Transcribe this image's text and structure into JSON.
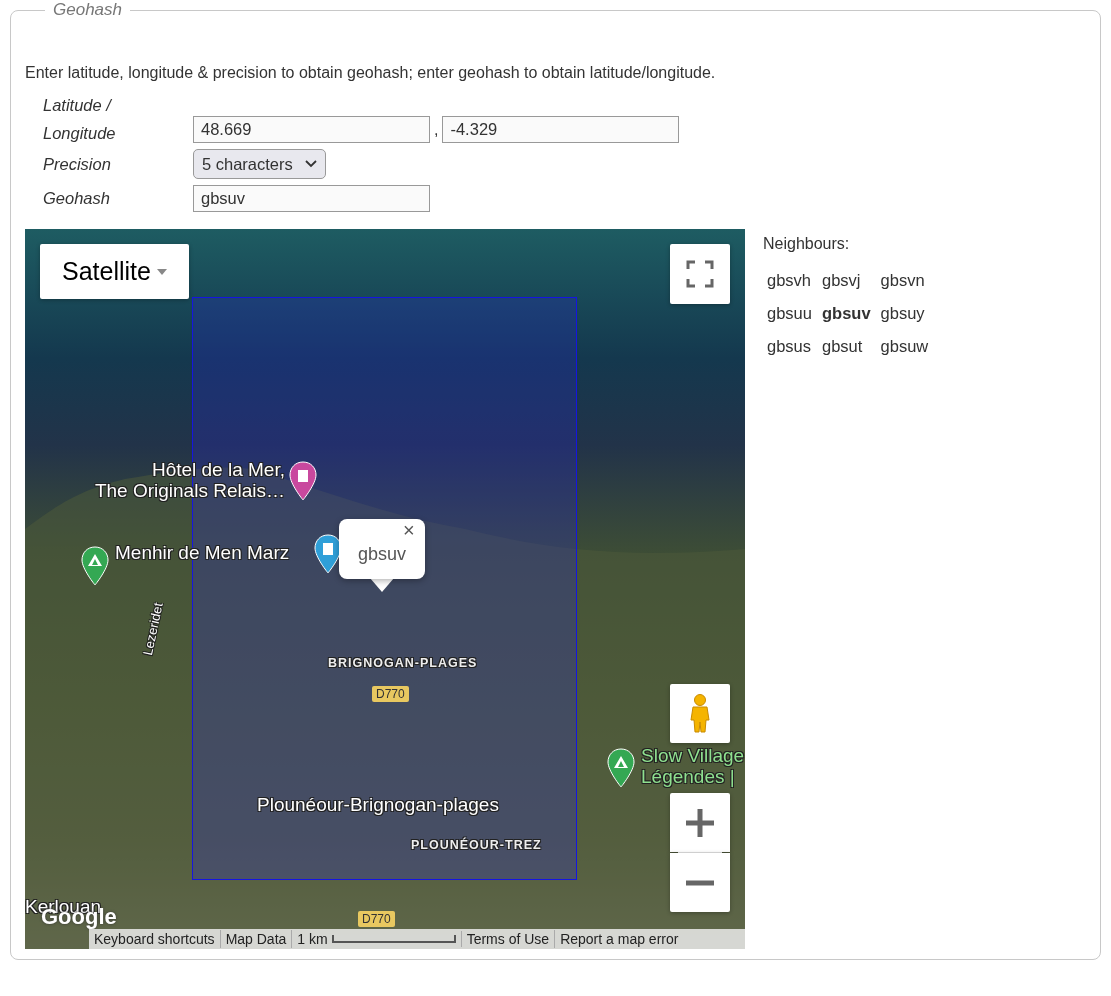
{
  "legend": "Geohash",
  "intro": "Enter latitude, longitude & precision to obtain geohash; enter geohash to obtain latitude/longitude.",
  "form": {
    "latlon_label_line1": "Latitude /",
    "latlon_label_line2": "Longitude",
    "latitude": "48.669",
    "separator": ",",
    "longitude": "-4.329",
    "precision_label": "Precision",
    "precision": "5 characters",
    "geohash_label": "Geohash",
    "geohash": "gbsuv"
  },
  "map": {
    "map_type": "Satellite",
    "labels": [
      {
        "kind": "poi",
        "text": "Hôtel de la Mer,",
        "text2": "The Originals Relais…",
        "color": "#c9489e"
      },
      {
        "kind": "poi",
        "text": "Menhir de Men Marz",
        "color": "#2f9fd8"
      },
      {
        "kind": "place",
        "text": "BRIGNOGAN-PLAGES"
      },
      {
        "kind": "road",
        "text": "D770"
      },
      {
        "kind": "street",
        "text": "Lezeridet"
      },
      {
        "kind": "green",
        "text": "Slow Village",
        "text2": "Légendes |",
        "color": "#34a853"
      },
      {
        "kind": "town",
        "text": "Plounéour-Brignogan-plages"
      },
      {
        "kind": "place",
        "text": "PLOUNÉOUR-TREZ"
      },
      {
        "kind": "town",
        "text": "Kerlouan"
      },
      {
        "kind": "road",
        "text": "D770"
      }
    ],
    "pins": [
      {
        "kind": "camp",
        "color": "#34a853"
      }
    ],
    "info_window": {
      "text": "gbsuv",
      "close": "×"
    },
    "logo": "Google",
    "footer": [
      "Keyboard shortcuts",
      "Map Data",
      "1 km",
      "Terms of Use",
      "Report a map error"
    ]
  },
  "neighbours": {
    "title": "Neighbours:",
    "rows": [
      [
        {
          "hash": "gbsvh",
          "current": false
        },
        {
          "hash": "gbsvj",
          "current": false
        },
        {
          "hash": "gbsvn",
          "current": false
        }
      ],
      [
        {
          "hash": "gbsuu",
          "current": false
        },
        {
          "hash": "gbsuv",
          "current": true
        },
        {
          "hash": "gbsuy",
          "current": false
        }
      ],
      [
        {
          "hash": "gbsus",
          "current": false
        },
        {
          "hash": "gbsut",
          "current": false
        },
        {
          "hash": "gbsuw",
          "current": false
        }
      ]
    ]
  }
}
